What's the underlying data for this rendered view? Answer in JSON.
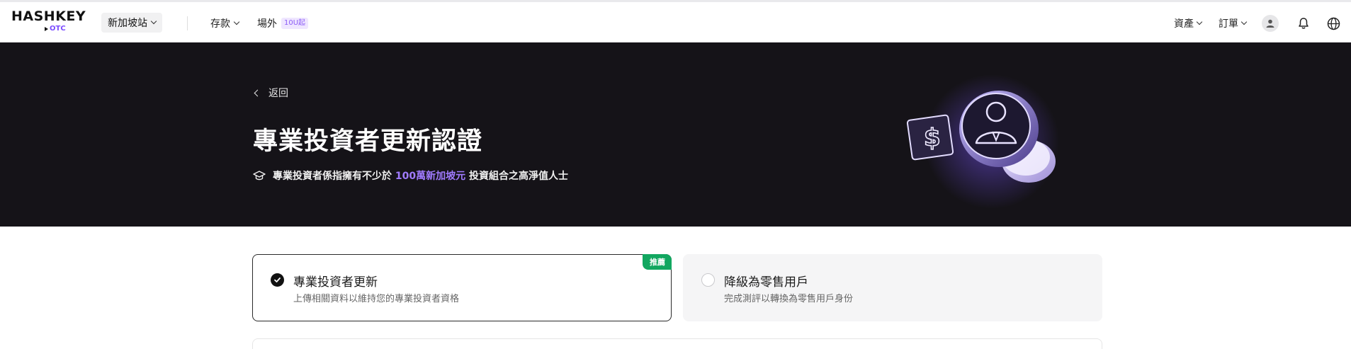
{
  "brand": {
    "name": "HASHKEY",
    "product": "OTC"
  },
  "nav": {
    "region": "新加坡站",
    "deposit": "存款",
    "otc": "場外",
    "otc_badge": "10U起",
    "assets": "資產",
    "orders": "訂單"
  },
  "hero": {
    "back_label": "返回",
    "title": "專業投資者更新認證",
    "desc_before": "專業投資者係指擁有不少於",
    "desc_highlight": "100萬新加坡元",
    "desc_after": "投資組合之高淨值人士"
  },
  "options": [
    {
      "title": "專業投資者更新",
      "subtitle": "上傳相關資料以維持您的專業投資者資格",
      "badge": "推薦",
      "selected": true
    },
    {
      "title": "降級為零售用戶",
      "subtitle": "完成測評以轉換為零售用戶身份",
      "selected": false
    }
  ],
  "colors": {
    "accent": "#a07bff",
    "hero_bg": "#151318",
    "recommend_badge": "#12a760"
  }
}
